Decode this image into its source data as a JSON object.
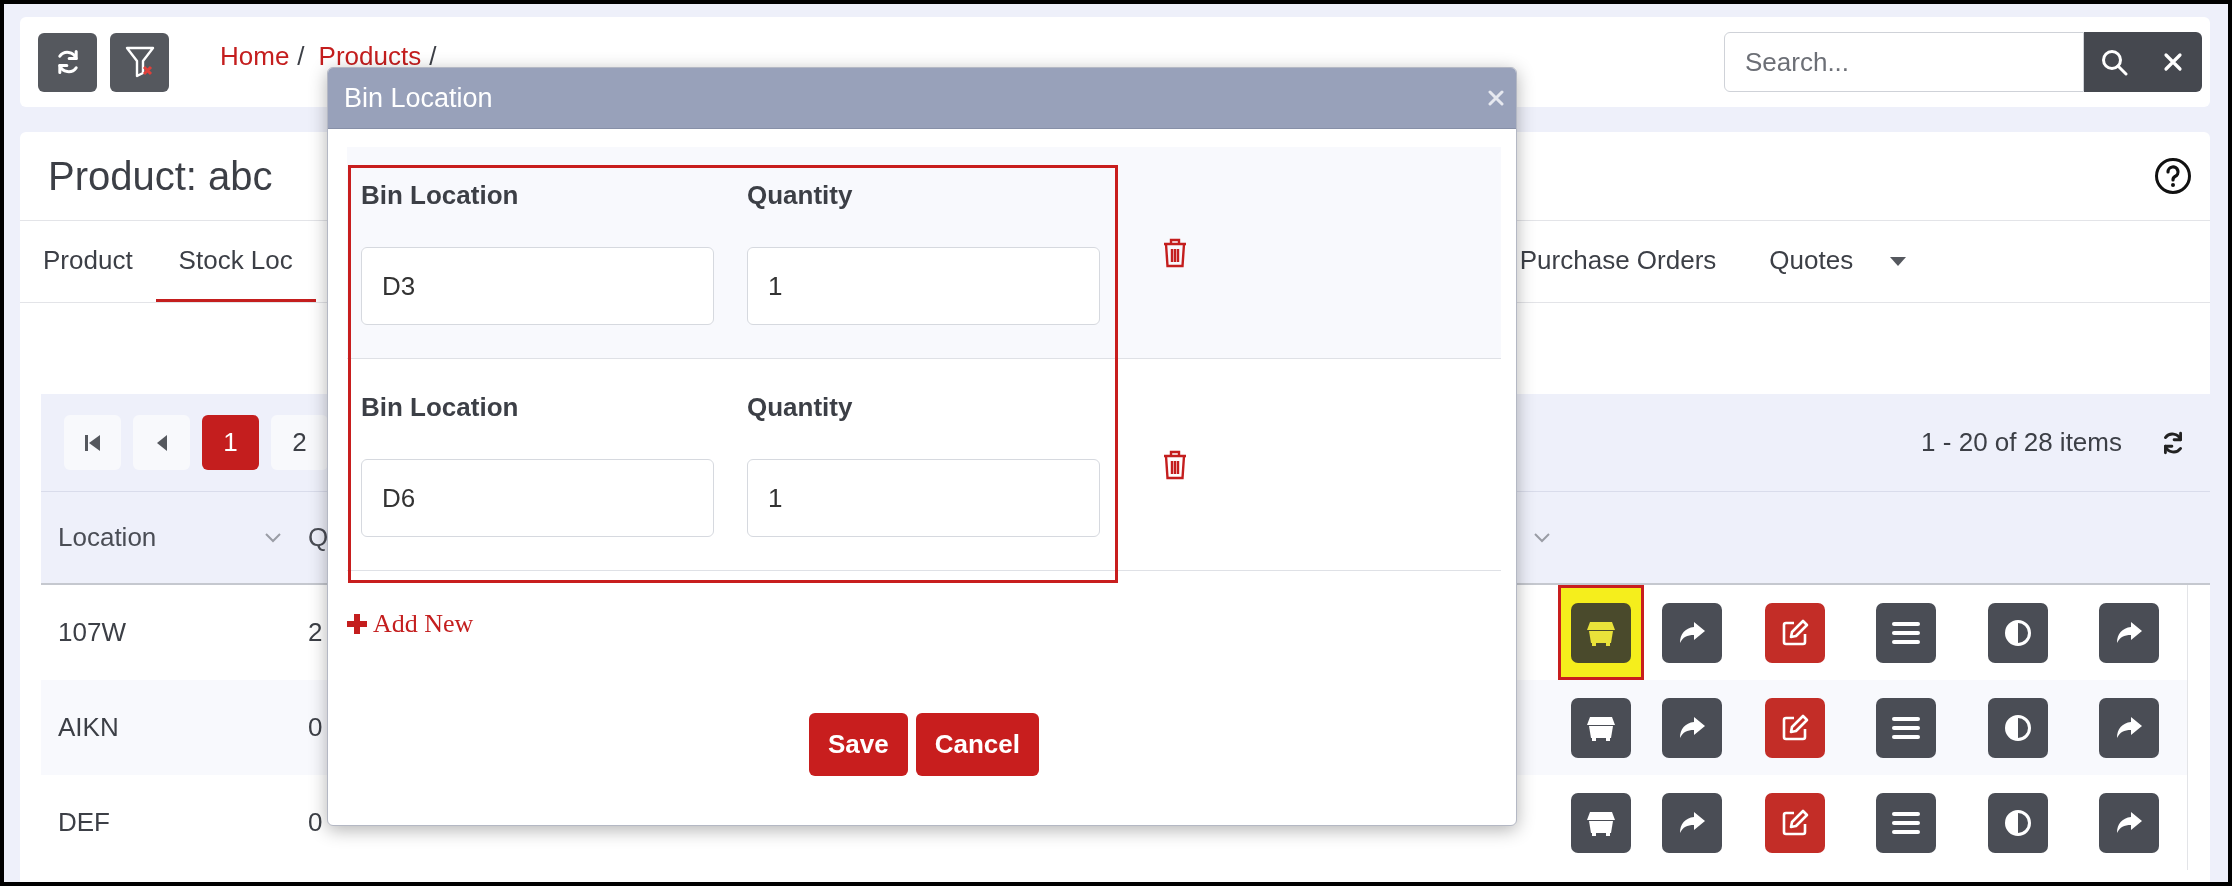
{
  "breadcrumb": [
    {
      "label": "Home",
      "separator": "/"
    },
    {
      "label": "Products",
      "separator": "/"
    }
  ],
  "search": {
    "placeholder": "Search..."
  },
  "page_title": "Product: abc",
  "tabs": [
    {
      "label": "Product",
      "selected": false
    },
    {
      "label": "Stock Loc",
      "selected": true
    },
    {
      "label": "Purchase Orders",
      "selected": false
    },
    {
      "label": "Quotes",
      "selected": false
    }
  ],
  "pager": {
    "pages": [
      {
        "label": "1",
        "selected": true
      },
      {
        "label": "2",
        "selected": false
      }
    ],
    "summary": "1 - 20 of 28 items"
  },
  "table": {
    "columns": [
      "Location",
      "Q"
    ],
    "rows": [
      {
        "cells": [
          "107W",
          "2"
        ],
        "highlighted": true
      },
      {
        "cells": [
          "AIKN",
          "0"
        ],
        "highlighted": false
      },
      {
        "cells": [
          "DEF",
          "0"
        ],
        "highlighted": false
      }
    ]
  },
  "modal": {
    "title": "Bin Location",
    "frame_highlighted": true,
    "entries": [
      {
        "bin_label": "Bin Location",
        "bin_value": "D3",
        "qty_label": "Quantity",
        "qty_value": "1"
      },
      {
        "bin_label": "Bin Location",
        "bin_value": "D6",
        "qty_label": "Quantity",
        "qty_value": "1"
      }
    ],
    "add_label": "Add New",
    "buttons": [
      "Save",
      "Cancel"
    ]
  }
}
